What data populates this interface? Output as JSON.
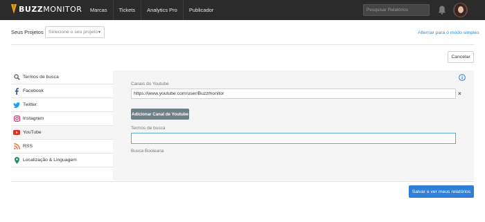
{
  "brand": {
    "name_bold": "BUZZ",
    "name_rest": "MONITOR",
    "accent": "#f5a623"
  },
  "nav": {
    "items": [
      {
        "label": "Marcas"
      },
      {
        "label": "Tickets"
      },
      {
        "label": "Analytics Pro"
      },
      {
        "label": "Publicador"
      }
    ]
  },
  "header": {
    "search_placeholder": "Pesquisar Relatórios"
  },
  "project": {
    "label": "Seus Projetos",
    "select_placeholder": "Selecione o seu projeto",
    "simple_mode_link": "Alternar para o modo simples"
  },
  "actions": {
    "cancel": "Cancelar",
    "save": "Salvar e ver meus relatórios"
  },
  "sidebar": {
    "items": [
      {
        "label": "Termos de busca",
        "icon": "search-icon",
        "color": "#555555"
      },
      {
        "label": "Facebook",
        "icon": "facebook-icon",
        "color": "#3b5998"
      },
      {
        "label": "Twitter",
        "icon": "twitter-icon",
        "color": "#1da1f2"
      },
      {
        "label": "Instagram",
        "icon": "instagram-icon",
        "color": "#c13584"
      },
      {
        "label": "YouTube",
        "icon": "youtube-icon",
        "color": "#e52d27"
      },
      {
        "label": "RSS",
        "icon": "rss-icon",
        "color": "#f26522"
      },
      {
        "label": "Localização & Linguagem",
        "icon": "location-pin-icon",
        "color": "#1e8a6e"
      }
    ]
  },
  "form": {
    "youtube_label": "Canais do Youtube",
    "youtube_value": "https://www.youtube.com/user/Buzzmonitor",
    "add_channel_button": "Adicionar Canal de Youtube",
    "terms_label": "Termos de busca",
    "terms_value": "",
    "boolean_label": "Busca Booleana"
  }
}
